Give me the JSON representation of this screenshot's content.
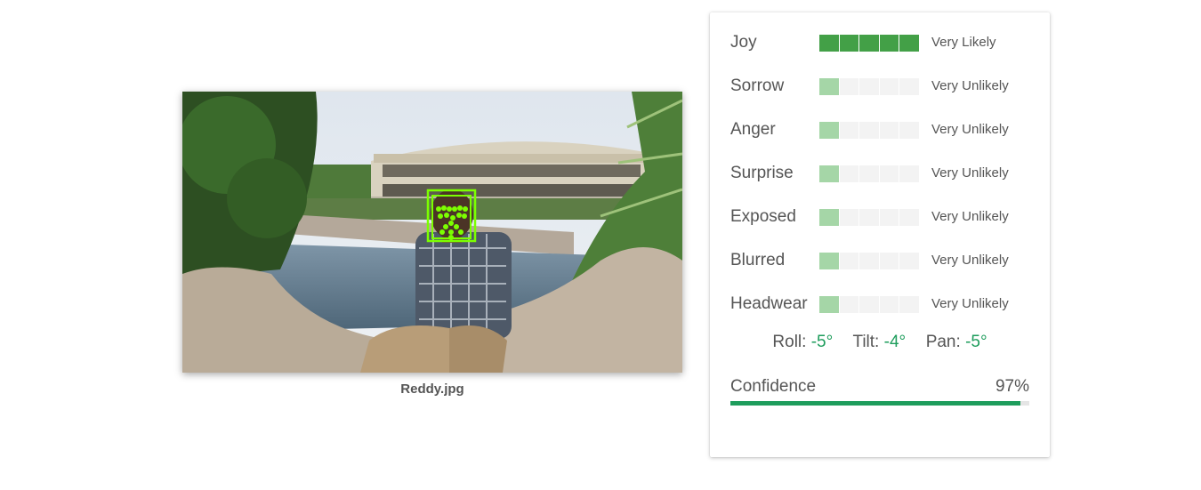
{
  "image": {
    "filename": "Reddy.jpg",
    "face_box_color": "#7cff00"
  },
  "attributes": [
    {
      "label": "Joy",
      "level": 5,
      "value": "Very Likely"
    },
    {
      "label": "Sorrow",
      "level": 1,
      "value": "Very Unlikely"
    },
    {
      "label": "Anger",
      "level": 1,
      "value": "Very Unlikely"
    },
    {
      "label": "Surprise",
      "level": 1,
      "value": "Very Unlikely"
    },
    {
      "label": "Exposed",
      "level": 1,
      "value": "Very Unlikely"
    },
    {
      "label": "Blurred",
      "level": 1,
      "value": "Very Unlikely"
    },
    {
      "label": "Headwear",
      "level": 1,
      "value": "Very Unlikely"
    }
  ],
  "angles": {
    "roll_label": "Roll:",
    "roll_value": "-5°",
    "tilt_label": "Tilt:",
    "tilt_value": "-4°",
    "pan_label": "Pan:",
    "pan_value": "-5°"
  },
  "confidence": {
    "label": "Confidence",
    "value_text": "97%",
    "fraction": 0.97
  },
  "colors": {
    "strong": "#43a047",
    "weak": "#a5d6a7",
    "accent": "#1e9d5c",
    "empty": "#f3f3f3"
  }
}
